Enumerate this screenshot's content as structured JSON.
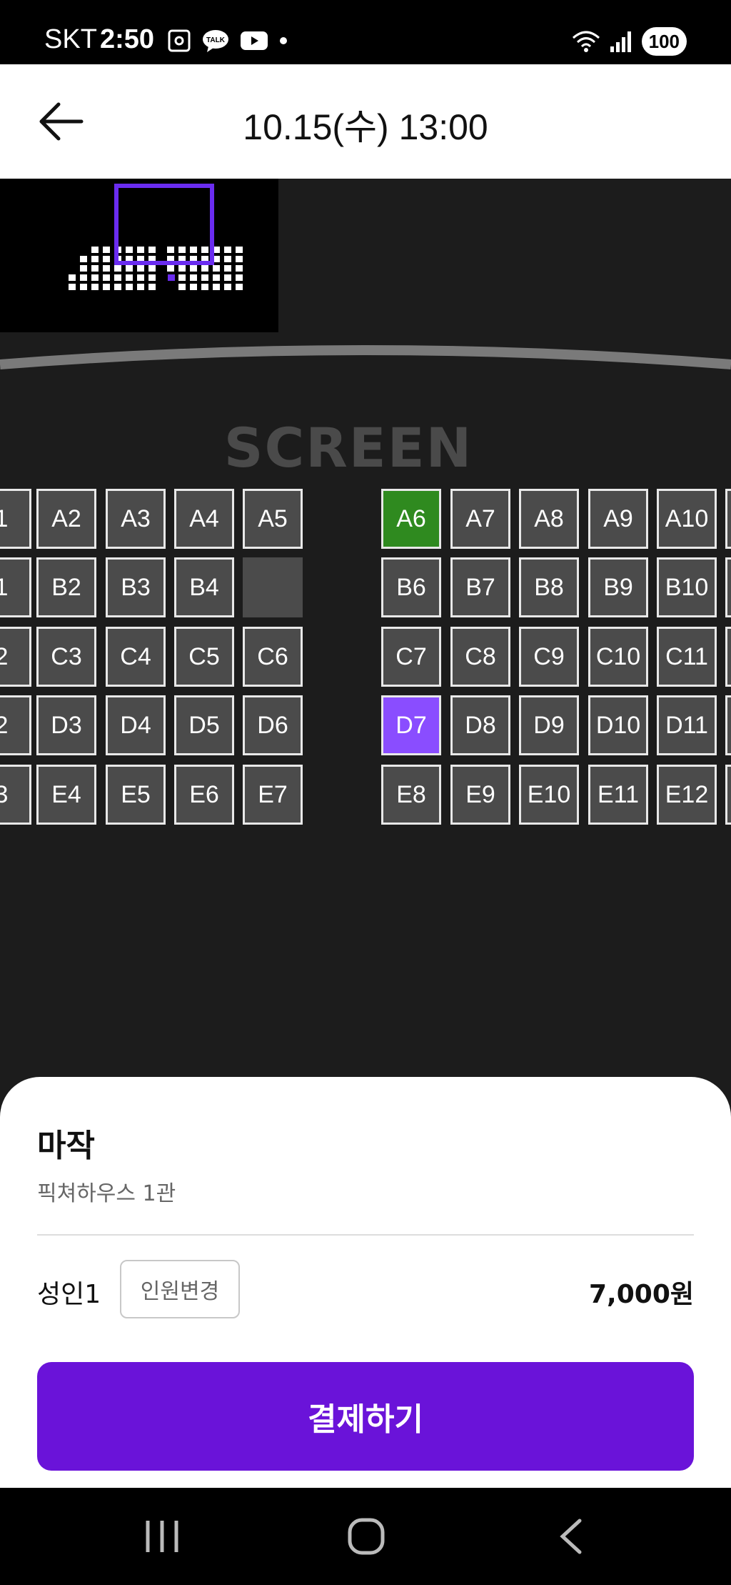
{
  "status_bar": {
    "carrier": "SKT",
    "time": "2:50",
    "battery": "100",
    "icons": [
      "screenshot-icon",
      "kakaotalk-icon",
      "youtube-icon",
      "notification-dot-icon",
      "wifi-icon",
      "signal-icon"
    ]
  },
  "header": {
    "title": "10.15(수) 13:00",
    "back_icon": "arrow-left-icon"
  },
  "seat_map": {
    "screen_label": "SCREEN",
    "left_block": [
      [
        "1",
        "A2",
        "A3",
        "A4",
        "A5"
      ],
      [
        "1",
        "B2",
        "B3",
        "B4",
        ""
      ],
      [
        "2",
        "C3",
        "C4",
        "C5",
        "C6"
      ],
      [
        "2",
        "D3",
        "D4",
        "D5",
        "D6"
      ],
      [
        "3",
        "E4",
        "E5",
        "E6",
        "E7"
      ]
    ],
    "right_block": [
      [
        "A6",
        "A7",
        "A8",
        "A9",
        "A10"
      ],
      [
        "B6",
        "B7",
        "B8",
        "B9",
        "B10"
      ],
      [
        "C7",
        "C8",
        "C9",
        "C10",
        "C11"
      ],
      [
        "D7",
        "D8",
        "D9",
        "D10",
        "D11"
      ],
      [
        "E8",
        "E9",
        "E10",
        "E11",
        "E12"
      ]
    ],
    "highlighted": {
      "A6": "#2f8a1f",
      "D7": "#8a4dff"
    }
  },
  "booking": {
    "movie_title": "마작",
    "theater": "픽쳐하우스 1관",
    "people": "성인1",
    "change_button": "인원변경",
    "price": "7,000원",
    "pay_button": "결제하기"
  },
  "colors": {
    "accent": "#6a13d9",
    "seat": "#4b4b4b",
    "background": "#1c1c1c"
  },
  "nav_bar": {
    "icons": [
      "recent-apps-icon",
      "home-icon",
      "back-icon"
    ]
  }
}
